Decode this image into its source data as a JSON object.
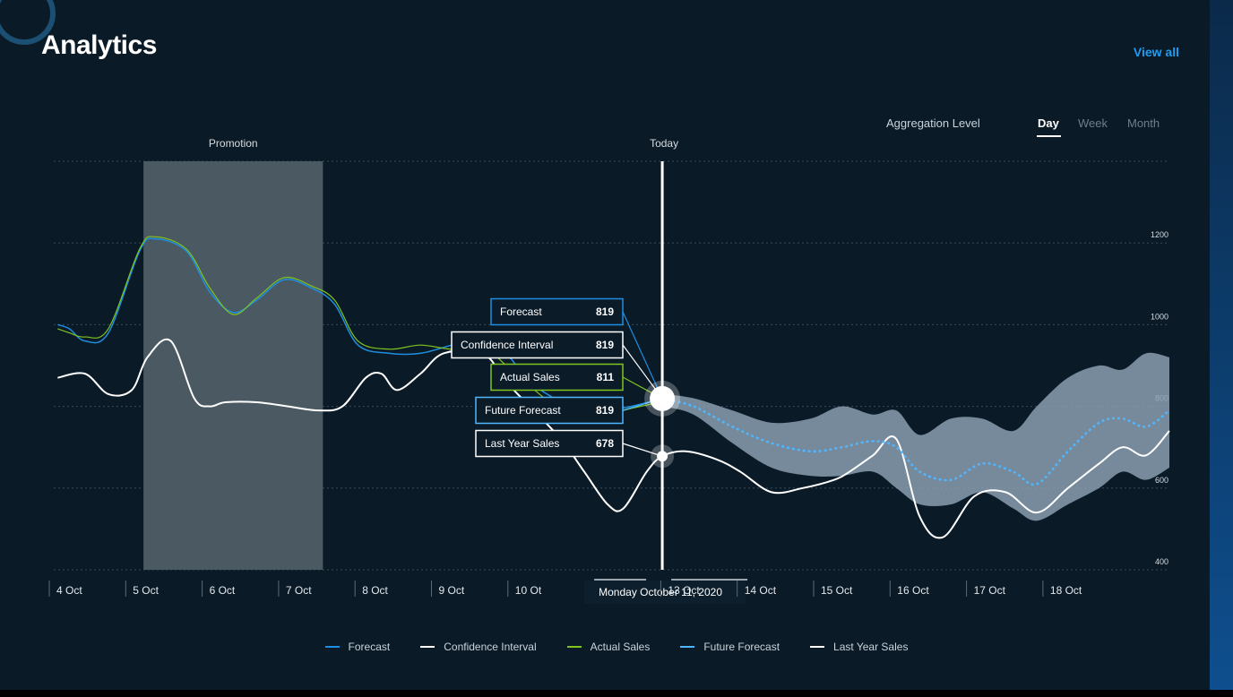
{
  "header": {
    "title": "Analytics",
    "view_all": "View all"
  },
  "aggregation": {
    "label": "Aggregation Level",
    "options": [
      "Day",
      "Week",
      "Month"
    ],
    "selected": "Day"
  },
  "colors": {
    "background": "#0a1a27",
    "forecast": "#1e8fe0",
    "confidence_band": "#8a9fb0",
    "actual": "#7fc41f",
    "future_forecast": "#4fb6ff",
    "last_year": "#ffffff",
    "promotion_band": "#4b5962",
    "accent_link": "#1e9df0"
  },
  "chart_data": {
    "type": "line",
    "x_categories": [
      "4 Oct",
      "5 Oct",
      "6 Oct",
      "7 Oct",
      "8 Oct",
      "9 Oct",
      "10 Ot",
      "Monday October 11, 2020",
      "13 Oct",
      "14 Oct",
      "15 Oct",
      "16 Oct",
      "17 Oct",
      "18 Oct"
    ],
    "x_range": [
      4,
      18.3
    ],
    "y_ticks": [
      400,
      600,
      800,
      1000,
      1200
    ],
    "y_range": [
      400,
      1400
    ],
    "today_x": 11.8,
    "today_label": "Today",
    "promotion": {
      "label": "Promotion",
      "x_start": 5.15,
      "x_end": 7.45
    },
    "current_date_label": "Monday October 11, 2020",
    "series": [
      {
        "name": "Forecast",
        "key": "forecast",
        "x": [
          4.05,
          4.2,
          4.4,
          4.7,
          5.1,
          5.3,
          5.7,
          6.0,
          6.3,
          6.6,
          6.95,
          7.3,
          7.6,
          7.9,
          8.3,
          8.7,
          9.1,
          9.5,
          9.8,
          10.1,
          10.5,
          10.8,
          11.1,
          11.4,
          11.8
        ],
        "y": [
          1000,
          990,
          960,
          980,
          1180,
          1210,
          1180,
          1080,
          1030,
          1060,
          1110,
          1090,
          1050,
          950,
          930,
          930,
          950,
          970,
          930,
          860,
          810,
          780,
          790,
          800,
          819
        ]
      },
      {
        "name": "Actual Sales",
        "key": "actual",
        "x": [
          4.05,
          4.2,
          4.4,
          4.7,
          5.1,
          5.3,
          5.7,
          6.0,
          6.3,
          6.6,
          6.95,
          7.3,
          7.6,
          7.9,
          8.3,
          8.7,
          9.1,
          9.5,
          9.8,
          10.1,
          10.5,
          10.8,
          11.1,
          11.4,
          11.8
        ],
        "y": [
          990,
          980,
          970,
          990,
          1185,
          1215,
          1185,
          1090,
          1025,
          1065,
          1115,
          1095,
          1060,
          960,
          940,
          950,
          940,
          945,
          900,
          850,
          790,
          770,
          780,
          795,
          811
        ]
      },
      {
        "name": "Future Forecast",
        "key": "future_forecast",
        "x": [
          11.8,
          12.2,
          12.7,
          13.2,
          13.7,
          14.1,
          14.5,
          14.8,
          15.1,
          15.5,
          15.9,
          16.3,
          16.6,
          17.0,
          17.4,
          17.7,
          18.0,
          18.3
        ],
        "y": [
          819,
          800,
          750,
          710,
          690,
          700,
          715,
          700,
          640,
          620,
          660,
          640,
          610,
          690,
          760,
          770,
          750,
          790
        ]
      },
      {
        "name": "Confidence Interval",
        "key": "confidence",
        "x": [
          11.8,
          12.2,
          12.7,
          13.2,
          13.7,
          14.1,
          14.5,
          14.8,
          15.1,
          15.5,
          15.9,
          16.3,
          16.6,
          17.0,
          17.4,
          17.7,
          18.0,
          18.3
        ],
        "upper": [
          830,
          820,
          790,
          760,
          770,
          800,
          780,
          790,
          730,
          770,
          770,
          740,
          800,
          870,
          900,
          890,
          930,
          920
        ],
        "lower": [
          800,
          780,
          710,
          650,
          630,
          630,
          640,
          600,
          560,
          560,
          590,
          550,
          520,
          560,
          600,
          640,
          620,
          650
        ]
      },
      {
        "name": "Last Year Sales",
        "key": "last_year",
        "x": [
          4.05,
          4.4,
          4.7,
          5.0,
          5.2,
          5.5,
          5.8,
          6.0,
          6.2,
          6.6,
          7.0,
          7.4,
          7.7,
          8.0,
          8.2,
          8.4,
          8.7,
          9.0,
          9.5,
          9.8,
          10.1,
          10.5,
          10.8,
          11.1,
          11.3,
          11.6,
          11.8,
          12.1,
          12.5,
          12.8,
          13.2,
          13.6,
          14.0,
          14.2,
          14.5,
          14.8,
          15.1,
          15.4,
          15.8,
          16.2,
          16.6,
          17.0,
          17.4,
          17.7,
          18.0,
          18.3
        ],
        "y": [
          870,
          880,
          830,
          840,
          920,
          960,
          820,
          800,
          810,
          810,
          800,
          790,
          800,
          870,
          880,
          840,
          880,
          930,
          930,
          860,
          800,
          720,
          640,
          560,
          550,
          640,
          678,
          690,
          670,
          640,
          590,
          600,
          620,
          640,
          680,
          720,
          530,
          480,
          580,
          590,
          540,
          600,
          660,
          700,
          680,
          740
        ]
      }
    ],
    "tooltip": [
      {
        "label": "Forecast",
        "value": "819",
        "key": "forecast"
      },
      {
        "label": "Confidence Interval",
        "value": "819",
        "key": "confidence"
      },
      {
        "label": "Actual Sales",
        "value": "811",
        "key": "actual"
      },
      {
        "label": "Future Forecast",
        "value": "819",
        "key": "future_forecast"
      },
      {
        "label": "Last Year Sales",
        "value": "678",
        "key": "last_year"
      }
    ],
    "legend_position": "bottom-center",
    "grid": true
  }
}
